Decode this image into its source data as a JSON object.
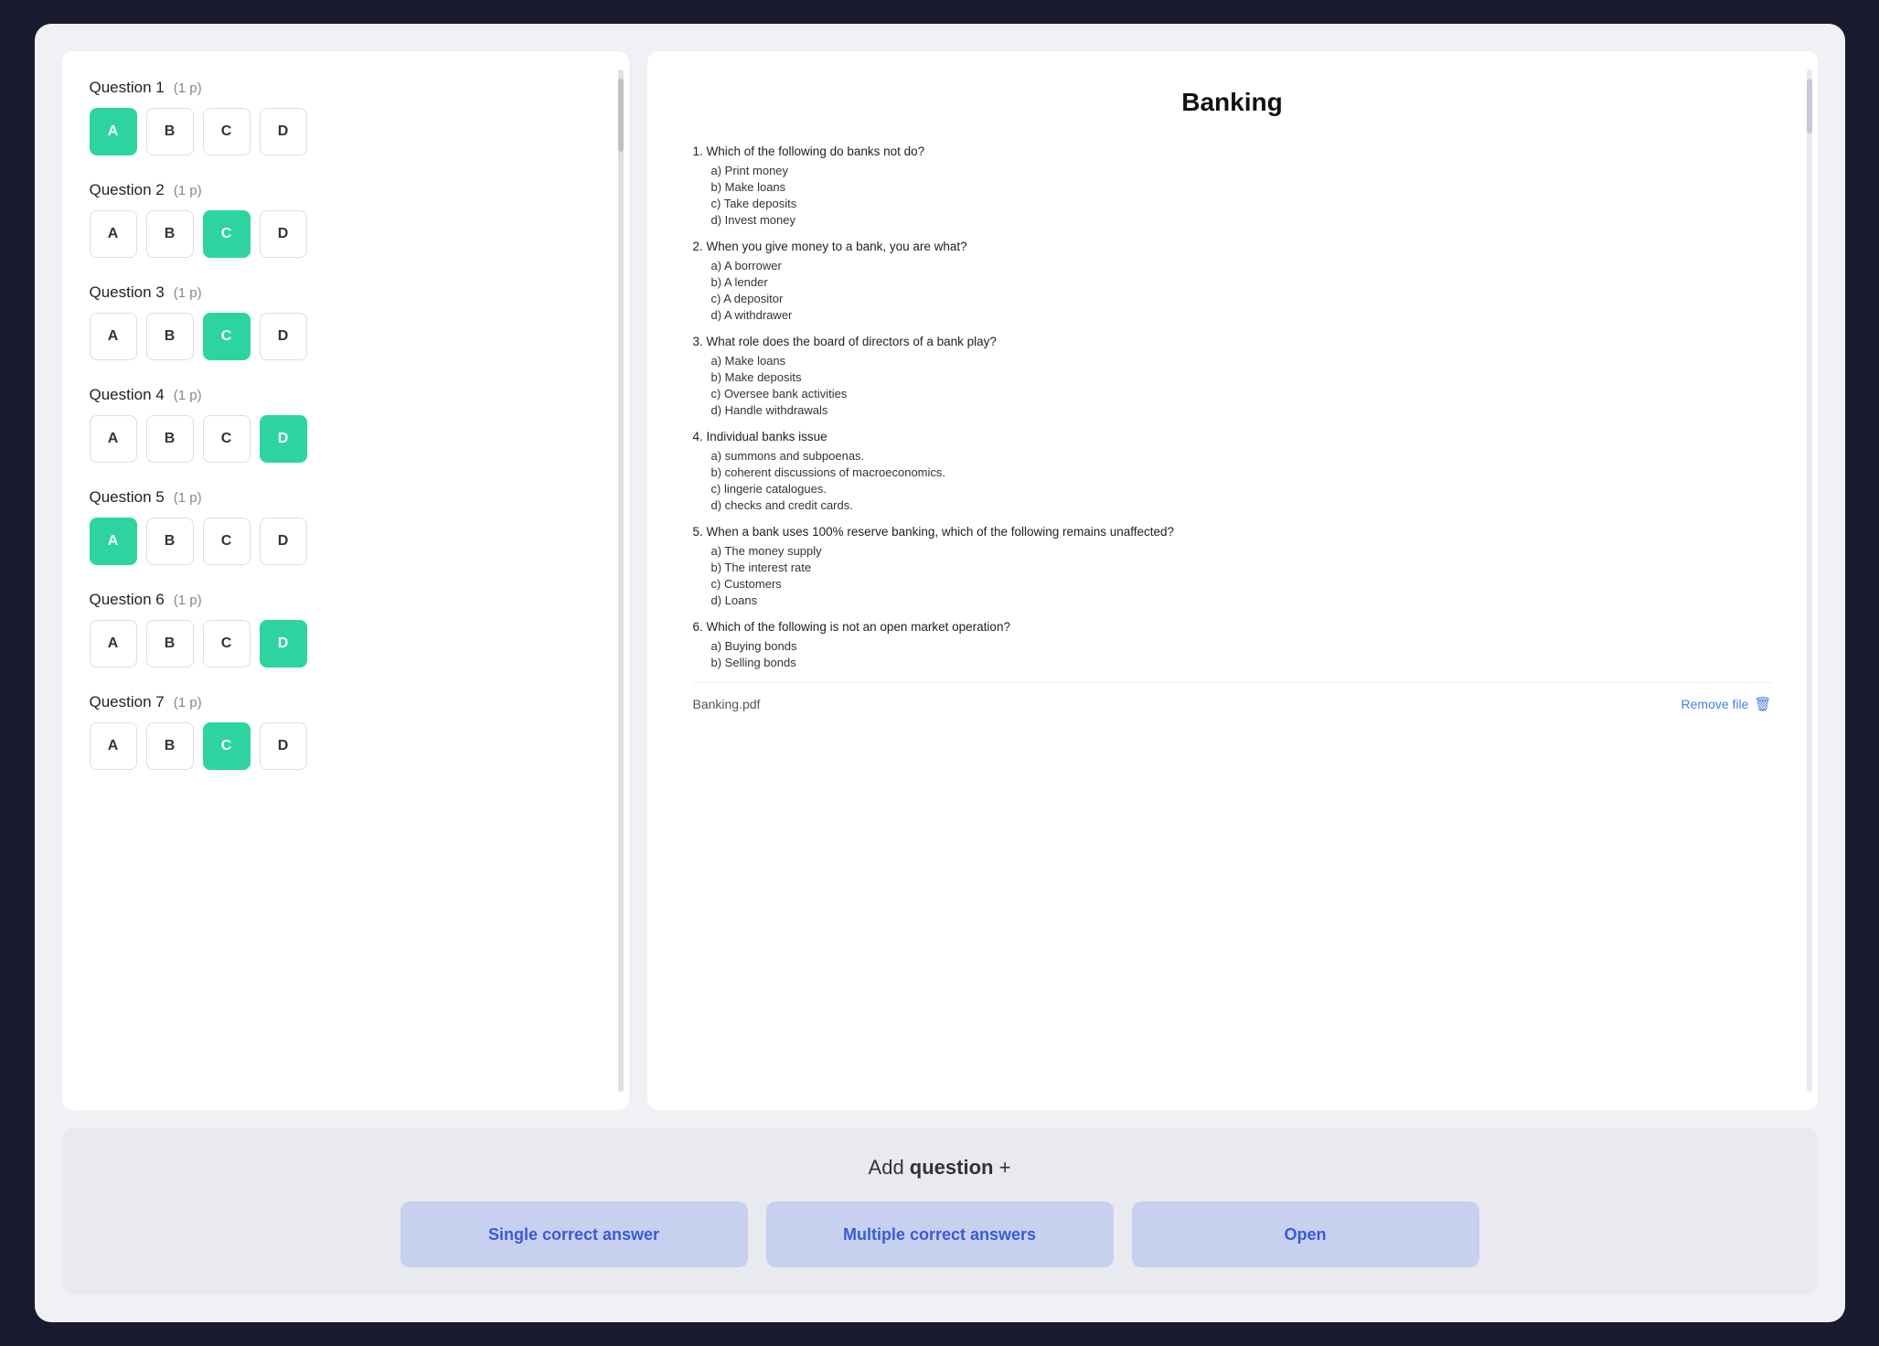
{
  "leftPanel": {
    "questions": [
      {
        "id": 1,
        "label": "Question 1",
        "points": "(1 p)",
        "answers": [
          "A",
          "B",
          "C",
          "D"
        ],
        "selected": "A"
      },
      {
        "id": 2,
        "label": "Question 2",
        "points": "(1 p)",
        "answers": [
          "A",
          "B",
          "C",
          "D"
        ],
        "selected": "C"
      },
      {
        "id": 3,
        "label": "Question 3",
        "points": "(1 p)",
        "answers": [
          "A",
          "B",
          "C",
          "D"
        ],
        "selected": "C"
      },
      {
        "id": 4,
        "label": "Question 4",
        "points": "(1 p)",
        "answers": [
          "A",
          "B",
          "C",
          "D"
        ],
        "selected": "D"
      },
      {
        "id": 5,
        "label": "Question 5",
        "points": "(1 p)",
        "answers": [
          "A",
          "B",
          "C",
          "D"
        ],
        "selected": "A"
      },
      {
        "id": 6,
        "label": "Question 6",
        "points": "(1 p)",
        "answers": [
          "A",
          "B",
          "C",
          "D"
        ],
        "selected": "D"
      },
      {
        "id": 7,
        "label": "Question 7",
        "points": "(1 p)",
        "answers": [
          "A",
          "B",
          "C",
          "D"
        ],
        "selected": "C"
      }
    ]
  },
  "rightPanel": {
    "title": "Banking",
    "filename": "Banking.pdf",
    "removeFileLabel": "Remove file",
    "questions": [
      {
        "number": "1.",
        "text": "Which of the following do banks not do?",
        "options": [
          "a)  Print money",
          "b)  Make loans",
          "c)  Take deposits",
          "d)  Invest money"
        ]
      },
      {
        "number": "2.",
        "text": "When you give money to a bank, you are what?",
        "options": [
          "a)  A borrower",
          "b)  A lender",
          "c)  A depositor",
          "d)  A withdrawer"
        ]
      },
      {
        "number": "3.",
        "text": "What role does the board of directors of a bank play?",
        "options": [
          "a)  Make loans",
          "b)  Make deposits",
          "c)  Oversee bank activities",
          "d)  Handle withdrawals"
        ]
      },
      {
        "number": "4.",
        "text": "Individual banks issue",
        "options": [
          "a)  summons and subpoenas.",
          "b)  coherent discussions of macroeconomics.",
          "c)  lingerie catalogues.",
          "d)  checks and credit cards."
        ]
      },
      {
        "number": "5.",
        "text": "When a bank uses 100% reserve banking, which of the following remains unaffected?",
        "options": [
          "a)  The money supply",
          "b)  The interest rate",
          "c)  Customers",
          "d)  Loans"
        ]
      },
      {
        "number": "6.",
        "text": "Which of the following is not an open market operation?",
        "options": [
          "a)  Buying bonds",
          "b)  Selling bonds"
        ]
      }
    ]
  },
  "bottomSection": {
    "addQuestionText": "Add",
    "addQuestionBold": "question",
    "addQuestionPlus": "+",
    "buttons": [
      {
        "label": "Single correct answer",
        "id": "single"
      },
      {
        "label": "Multiple correct answers",
        "id": "multiple"
      },
      {
        "label": "Open",
        "id": "open"
      }
    ]
  }
}
